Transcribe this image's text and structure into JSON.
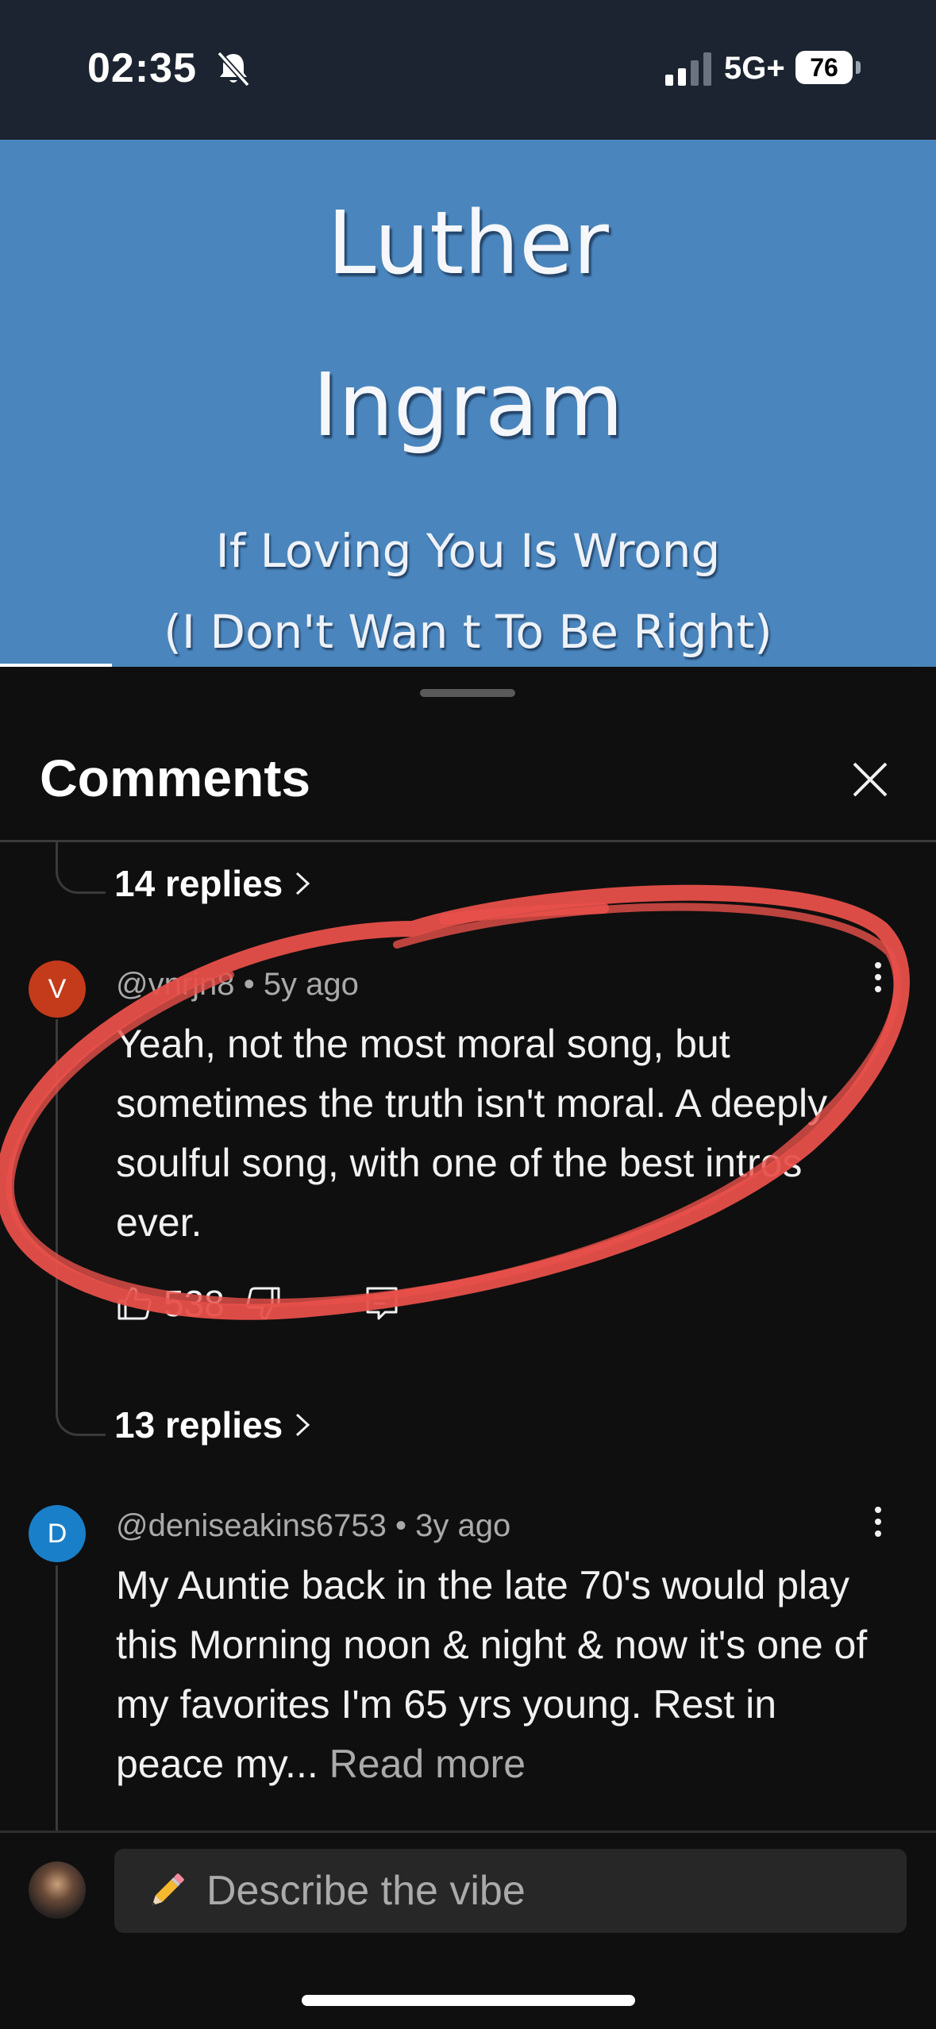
{
  "status_bar": {
    "time": "02:35",
    "network": "5G+",
    "battery": "76"
  },
  "video": {
    "artist_line1": "Luther",
    "artist_line2": "Ingram",
    "song_line1": "If Loving You Is Wrong",
    "song_line2": "(I Don't Wan t To Be Right)",
    "progress": 0.12
  },
  "comments_sheet": {
    "title": "Comments",
    "previous_thread": {
      "replies_label": "14 replies"
    },
    "comments": [
      {
        "avatar_letter": "V",
        "avatar_color": "#c43b1c",
        "author": "@vnrjn8",
        "age": "5y ago",
        "text": "Yeah, not the most moral song, but sometimes the truth isn't moral. A deeply soulful song, with one of the best intros ever.",
        "likes": "538",
        "replies_label": "13 replies"
      },
      {
        "avatar_letter": "D",
        "avatar_color": "#1a7fc9",
        "author": "@deniseakins6753",
        "age": "3y ago",
        "text": "My Auntie back in the late 70's would play this Morning  noon & night & now it's  one of my favorites I'm  65 yrs young. Rest in peace my...",
        "read_more": "Read more"
      }
    ]
  },
  "composer": {
    "placeholder": "Describe the vibe",
    "pencil_emoji": "✏️"
  },
  "colors": {
    "annotation": "#e8504a",
    "sheet_bg": "#0f0f0f",
    "video_bg": "#4a86bd"
  }
}
